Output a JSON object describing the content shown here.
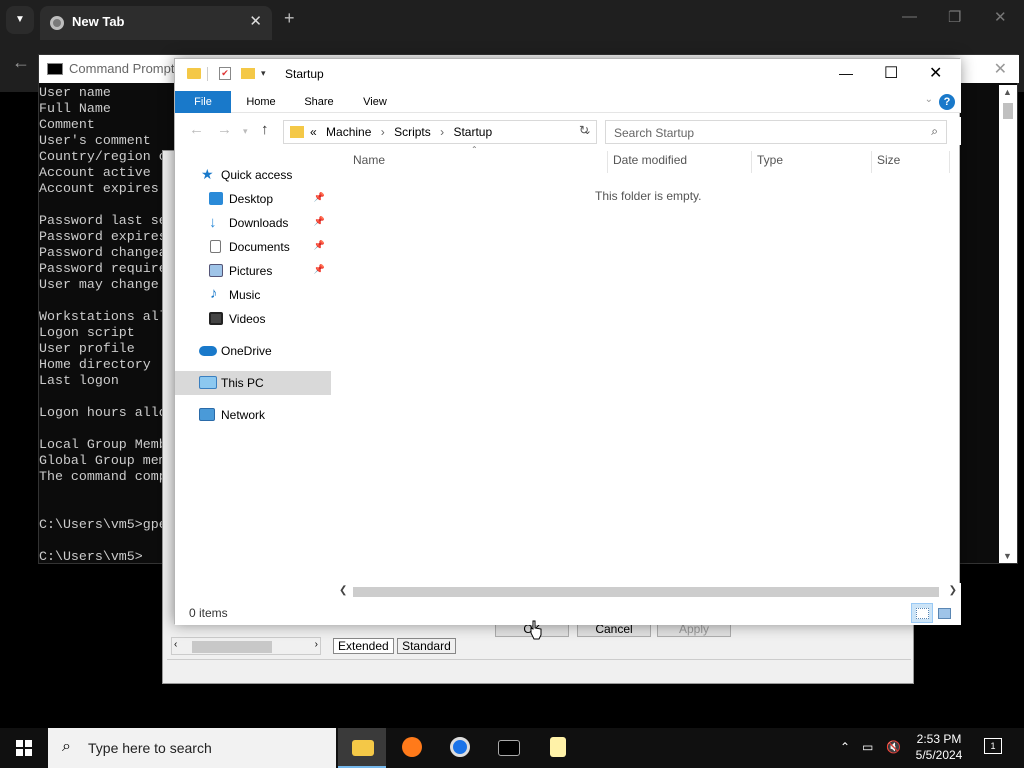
{
  "browser": {
    "tab_title": "New Tab",
    "tab_close": "✕",
    "new_tab": "+",
    "minimize": "—",
    "maximize": "❐",
    "close": "✕",
    "back": "←"
  },
  "cmd": {
    "title": "Command Prompt",
    "lines": [
      "User name",
      "Full Name",
      "Comment",
      "User's comment",
      "Country/region c",
      "Account active",
      "Account expires",
      "",
      "Password last se",
      "Password expires",
      "Password changea",
      "Password require",
      "User may change",
      "",
      "Workstations all",
      "Logon script",
      "User profile",
      "Home directory",
      "Last logon",
      "",
      "Logon hours allo",
      "",
      "Local Group Memb",
      "Global Group mem",
      "The command comp",
      "",
      "",
      "C:\\Users\\vm5>gpe",
      "",
      "C:\\Users\\vm5>"
    ]
  },
  "gpo_dialog": {
    "tab_extended": "Extended",
    "tab_standard": "Standard",
    "ok_label": "OK",
    "cancel_label": "Cancel",
    "apply_label": "Apply"
  },
  "explorer": {
    "title": "Startup",
    "ribbon_tabs": [
      "File",
      "Home",
      "Share",
      "View"
    ],
    "help": "?",
    "address": {
      "prefix": "«",
      "parts": [
        "Machine",
        "Scripts",
        "Startup"
      ],
      "sep": "›"
    },
    "search_placeholder": "Search Startup",
    "nav": [
      {
        "label": "Quick access",
        "icon": "star-icon"
      },
      {
        "label": "Desktop",
        "icon": "desktop-icon",
        "pinned": true
      },
      {
        "label": "Downloads",
        "icon": "downloads-icon",
        "pinned": true
      },
      {
        "label": "Documents",
        "icon": "documents-icon",
        "pinned": true
      },
      {
        "label": "Pictures",
        "icon": "pictures-icon",
        "pinned": true
      },
      {
        "label": "Music",
        "icon": "music-icon"
      },
      {
        "label": "Videos",
        "icon": "videos-icon"
      },
      {
        "label": "OneDrive",
        "icon": "cloud-icon"
      },
      {
        "label": "This PC",
        "icon": "computer-icon",
        "selected": true
      },
      {
        "label": "Network",
        "icon": "network-icon"
      }
    ],
    "columns": [
      "Name",
      "Date modified",
      "Type",
      "Size"
    ],
    "empty_message": "This folder is empty.",
    "status": "0 items"
  },
  "taskbar": {
    "search_placeholder": "Type here to search",
    "apps": [
      "file-explorer",
      "firefox",
      "chrome",
      "terminal",
      "notepad"
    ],
    "time": "2:53 PM",
    "date": "5/5/2024",
    "notifications": "1"
  },
  "colors": {
    "accent": "#1979ca",
    "folder": "#f4c847",
    "taskbar": "#101010"
  }
}
